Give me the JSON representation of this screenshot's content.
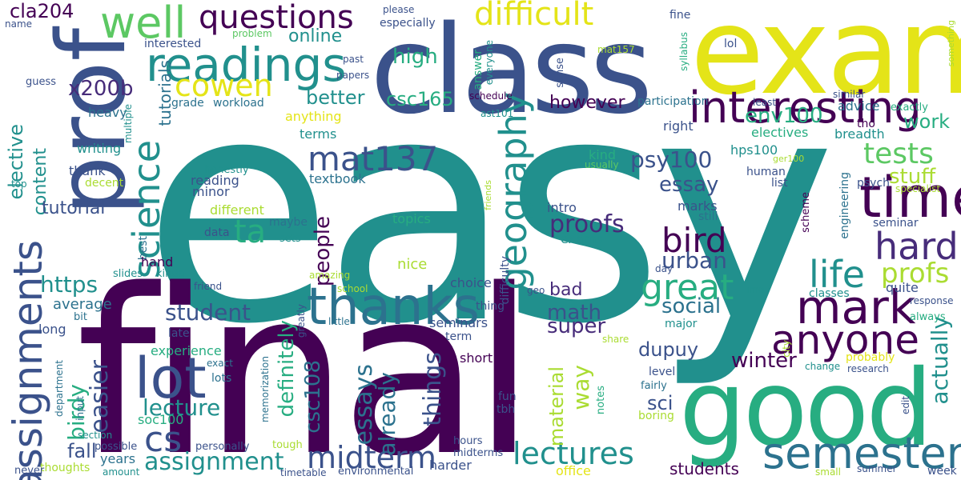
{
  "words": {
    "easy": "easy",
    "final": "final",
    "exam": "exam",
    "class": "class",
    "prof": "prof",
    "good": "good",
    "time": "time",
    "readings": "readings",
    "interesting": "interesting",
    "thanks": "thanks",
    "semester": "semester",
    "lot": "lot",
    "mark": "mark",
    "hard": "hard",
    "anyone": "anyone",
    "great": "great",
    "assignments": "assignments",
    "geography": "geography",
    "science": "science",
    "well": "well",
    "questions": "questions",
    "difficult": "difficult",
    "cowen": "cowen",
    "mat137": "mat137",
    "bird": "bird",
    "lectures": "lectures",
    "midterm": "midterm",
    "life": "life",
    "profs": "profs",
    "cs": "cs",
    "assignment": "assignment",
    "tests": "tests",
    "ta": "ta",
    "x200b": "x200b",
    "cla204": "cla204",
    "online": "online",
    "high": "high",
    "better": "better",
    "csc165": "csc165",
    "however": "however",
    "env100": "env100",
    "work": "work",
    "stuff": "stuff",
    "psy100": "psy100",
    "essay": "essay",
    "proofs": "proofs",
    "urban": "urban",
    "people": "people",
    "https": "https",
    "student": "student",
    "lecture": "lecture",
    "easier": "easier",
    "birdy": "birdy",
    "essays": "essays",
    "already": "already",
    "things": "things",
    "definitely": "definitely",
    "csc108": "csc108",
    "math": "math",
    "super": "super",
    "social": "social",
    "winter": "winter",
    "dupuy": "dupuy",
    "sci": "sci",
    "actually": "actually",
    "students": "students",
    "fall": "fall",
    "way": "way",
    "material": "material",
    "elective": "elective",
    "content": "content",
    "tutorial": "tutorial",
    "tutorials": "tutorials",
    "bad": "bad",
    "average": "average",
    "experience": "experience",
    "soc100": "soc100",
    "years": "years",
    "reading": "reading",
    "minor": "minor",
    "writing": "writing",
    "heavy": "heavy",
    "thank": "thank",
    "honestly": "honestly",
    "textbook": "textbook",
    "different": "different",
    "topics": "topics",
    "nice": "nice",
    "maybe": "maybe",
    "data": "data",
    "sets": "sets",
    "intro": "intro",
    "exams": "exams",
    "marks": "marks",
    "still": "still",
    "seminar": "seminar",
    "scheme": "scheme",
    "right": "right",
    "similar": "similar",
    "electives": "electives",
    "breadth": "breadth",
    "tho": "tho",
    "hps100": "hps100",
    "ger100": "ger100",
    "human": "human",
    "list": "list",
    "psych": "psych",
    "specialist": "specialist",
    "engineering": "engineering",
    "advice": "advice",
    "exactly": "exactly",
    "participation": "participation",
    "least": "least",
    "kind": "kind",
    "usually": "usually",
    "grade": "grade",
    "workload": "workload",
    "interested": "interested",
    "problem": "problem",
    "please": "please",
    "especially": "especially",
    "answer": "answer",
    "everyone": "everyone",
    "past": "past",
    "papers": "papers",
    "sense": "sense",
    "schedule": "schedule",
    "mat157": "mat157",
    "fine": "fine",
    "syllabus": "syllabus",
    "lol": "lol",
    "something": "something",
    "ast101": "ast101",
    "anything": "anything",
    "terms": "terms",
    "name": "name",
    "guess": "guess",
    "multiple": "multiple",
    "decent": "decent",
    "top": "top",
    "best": "best",
    "hand": "hand",
    "slides": "slides",
    "kinda": "kinda",
    "friend": "friend",
    "friends": "friends",
    "amazing": "amazing",
    "school": "school",
    "choice": "choice",
    "difficulty": "difficulty",
    "geo": "geo",
    "thing": "thing",
    "imo": "imo",
    "classes": "classes",
    "quite": "quite",
    "response": "response",
    "always": "always",
    "major": "major",
    "day": "day",
    "long": "long",
    "late": "late",
    "bit": "bit",
    "little": "little",
    "seminars": "seminars",
    "term": "term",
    "greatly": "greatly",
    "share": "share",
    "city": "city",
    "probably": "probably",
    "research": "research",
    "level": "level",
    "change": "change",
    "exact": "exact",
    "lots": "lots",
    "short": "short",
    "fun": "fun",
    "tbh": "tbh",
    "notes": "notes",
    "fairly": "fairly",
    "boring": "boring",
    "edit": "edit",
    "department": "department",
    "input": "input",
    "memorization": "memorization",
    "section": "section",
    "possible": "possible",
    "thoughts": "thoughts",
    "amount": "amount",
    "never": "never",
    "personally": "personally",
    "tough": "tough",
    "hours": "hours",
    "midterms": "midterms",
    "harder": "harder",
    "timetable": "timetable",
    "environmental": "environmental",
    "office": "office",
    "small": "small",
    "summer": "summer",
    "week": "week"
  }
}
